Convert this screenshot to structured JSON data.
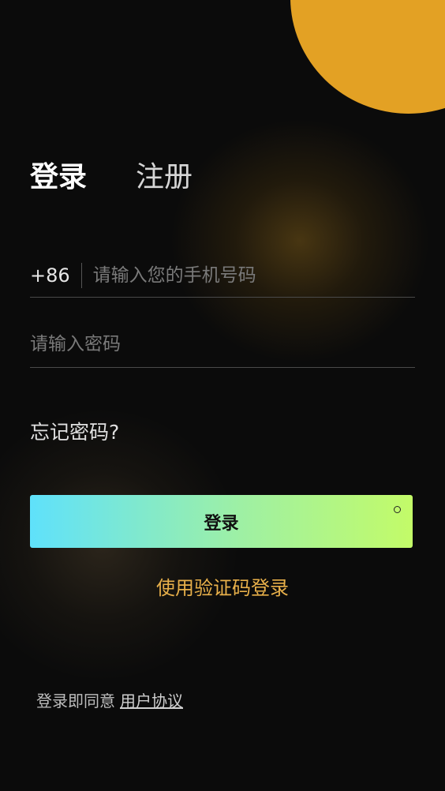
{
  "tabs": {
    "login": "登录",
    "register": "注册"
  },
  "phone": {
    "country_code": "+86",
    "placeholder": "请输入您的手机号码",
    "value": ""
  },
  "password": {
    "placeholder": "请输入密码",
    "value": ""
  },
  "forgot_password": "忘记密码?",
  "login_button": "登录",
  "sms_login": "使用验证码登录",
  "agreement": {
    "prefix": "登录即同意",
    "link": "用户协议"
  },
  "colors": {
    "background": "#0b0b0b",
    "accent_orange": "#e3a124",
    "link_gold": "#e8b04a",
    "button_gradient_start": "#5fe1fb",
    "button_gradient_end": "#c3fb68"
  },
  "icons": {
    "button_indicator": "circle-icon"
  }
}
